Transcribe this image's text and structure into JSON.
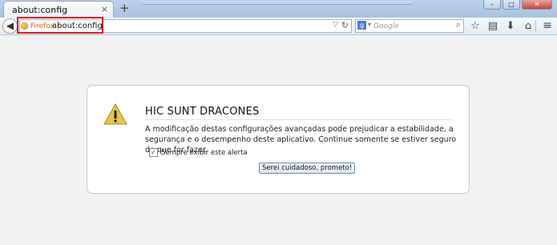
{
  "tabs": [
    {
      "title": "about:config",
      "close": "×"
    }
  ],
  "new_tab": "+",
  "window_controls": {
    "minimize": "–",
    "maximize": "□",
    "close": "✕"
  },
  "nav": {
    "back": "◀"
  },
  "url": {
    "identity_label": "Firefox",
    "text": "about:config",
    "dropdown": "▽",
    "reload": "↻"
  },
  "search": {
    "engine_letter": "g",
    "engine_arrow": "▾",
    "placeholder": "Google",
    "go": "⌕"
  },
  "toolbar": {
    "bookmark_star": "☆",
    "bookmarks_list": "▤",
    "downloads": "⬇",
    "home": "⌂",
    "menu": "≡"
  },
  "warning": {
    "title": "HIC SUNT DRACONES",
    "body": "A modificação destas configurações avançadas pode prejudicar a estabilidade, a segurança e o desempenho deste aplicativo. Continue somente se estiver seguro do que for fazer.",
    "checkbox_label": "Sempre exibir este alerta",
    "checkbox_checked": true,
    "button_label": "Serei cuidadoso, prometo!"
  },
  "colors": {
    "highlight_box": "#d0202a",
    "warning_triangle": "#e8c54a"
  },
  "icons": {
    "warning": "warning-triangle-icon"
  }
}
